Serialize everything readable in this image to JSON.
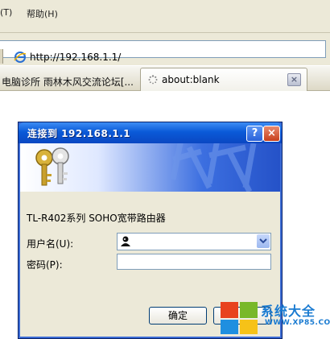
{
  "menubar": {
    "items": [
      {
        "label": "(T)"
      },
      {
        "label": "帮助(H)"
      }
    ]
  },
  "addressbar": {
    "url": "http://192.168.1.1/"
  },
  "tabs": [
    {
      "label": "电脑诊所 雨林木风交流论坛[..."
    },
    {
      "label": "about:blank",
      "close_icon": "×"
    }
  ],
  "dialog": {
    "title": "连接到 192.168.1.1",
    "help_button": "?",
    "close_button": "×",
    "router_text": "TL-R402系列 SOHO宽带路由器",
    "username_label": "用户名(U):",
    "password_label": "密码(P):",
    "username_value": "",
    "password_value": "",
    "ok_button": "确定",
    "cancel_button": ""
  },
  "watermark": {
    "text": "系统大全",
    "url": "WWW.XP85.COM"
  },
  "colors": {
    "title_blue": "#0a5ad8",
    "close_red": "#c8401c",
    "watermark_blue": "#1a7bd1"
  }
}
